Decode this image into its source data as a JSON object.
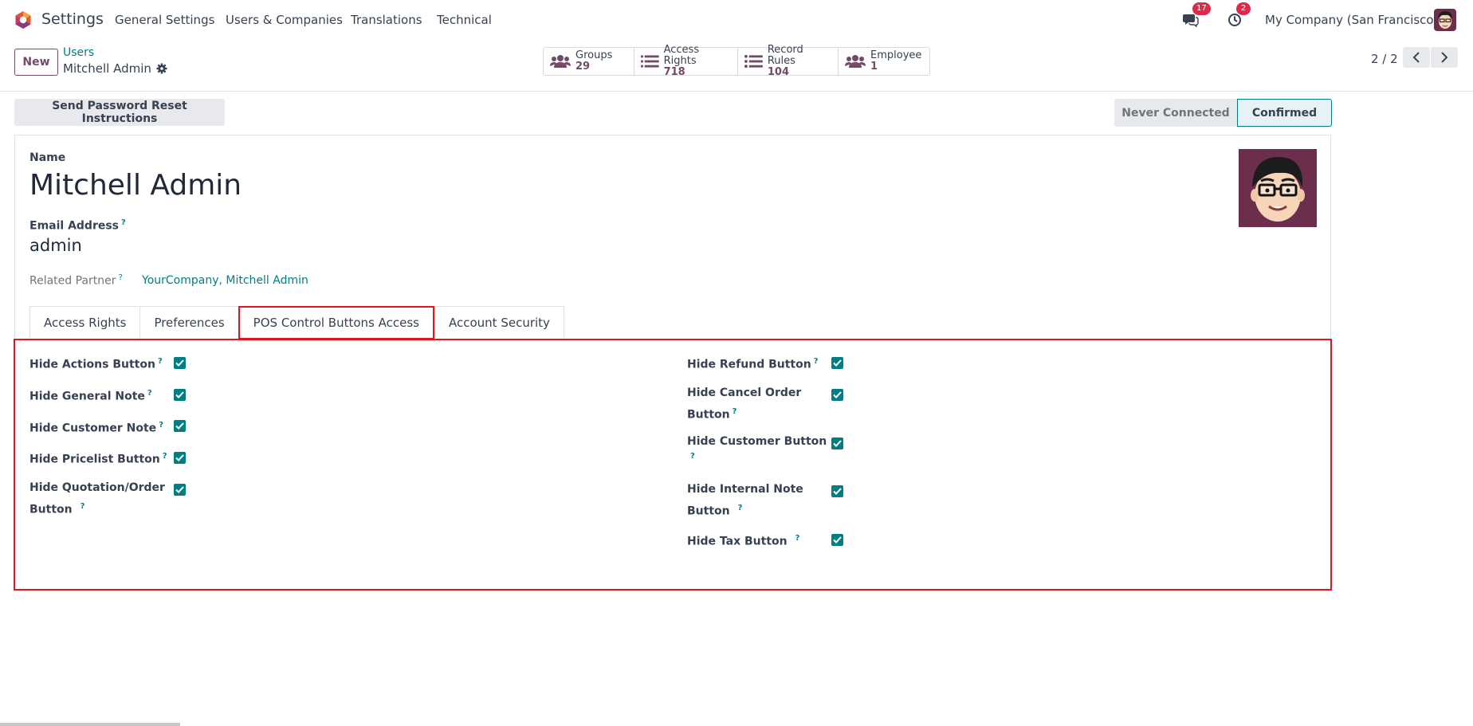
{
  "navbar": {
    "app_title": "Settings",
    "menu": [
      "General Settings",
      "Users & Companies",
      "Translations",
      "Technical"
    ],
    "messages_count": "17",
    "activities_count": "2",
    "company": "My Company (San Francisco)"
  },
  "control_panel": {
    "new_label": "New",
    "breadcrumb_parent": "Users",
    "breadcrumb_current": "Mitchell Admin",
    "smart_buttons": [
      {
        "label": "Groups",
        "value": "29",
        "icon": "users-icon"
      },
      {
        "label": "Access Rights",
        "value": "718",
        "icon": "list-icon"
      },
      {
        "label": "Record Rules",
        "value": "104",
        "icon": "list-icon"
      },
      {
        "label": "Employee",
        "value": "1",
        "icon": "users-icon"
      }
    ],
    "pager": "2 / 2"
  },
  "status": {
    "reset_button": "Send Password Reset Instructions",
    "stages": [
      "Never Connected",
      "Confirmed"
    ],
    "active_stage": "Confirmed"
  },
  "form": {
    "name_label": "Name",
    "name_value": "Mitchell Admin",
    "email_label": "Email Address",
    "email_value": "admin",
    "partner_label": "Related Partner",
    "partner_value": "YourCompany, Mitchell Admin",
    "help_mark": "?"
  },
  "tabs": [
    "Access Rights",
    "Preferences",
    "POS Control Buttons Access",
    "Account Security"
  ],
  "active_tab": "POS Control Buttons Access",
  "pos_fields": {
    "left": [
      {
        "line1": "Hide Actions Button",
        "line2": "",
        "checked": true
      },
      {
        "line1": "Hide General Note",
        "line2": "",
        "checked": true
      },
      {
        "line1": "Hide Customer Note",
        "line2": "",
        "checked": true
      },
      {
        "line1": "Hide Pricelist Button",
        "line2": "",
        "checked": true
      },
      {
        "line1": "Hide Quotation/Order",
        "line2": "Button",
        "checked": true
      }
    ],
    "right": [
      {
        "line1": "Hide Refund Button",
        "line2": "",
        "checked": true
      },
      {
        "line1": "Hide Cancel Order",
        "line2": "Button",
        "checked": true
      },
      {
        "line1": "Hide Customer Button",
        "line2": "",
        "checked": true
      },
      {
        "line1": "Hide Internal Note",
        "line2": "Button",
        "checked": true
      },
      {
        "line1": "Hide Tax Button",
        "line2": "",
        "checked": true
      }
    ]
  },
  "colors": {
    "brand": "#714b67",
    "link": "#017e84",
    "highlight": "#e0161b",
    "badge": "#e0284a"
  }
}
